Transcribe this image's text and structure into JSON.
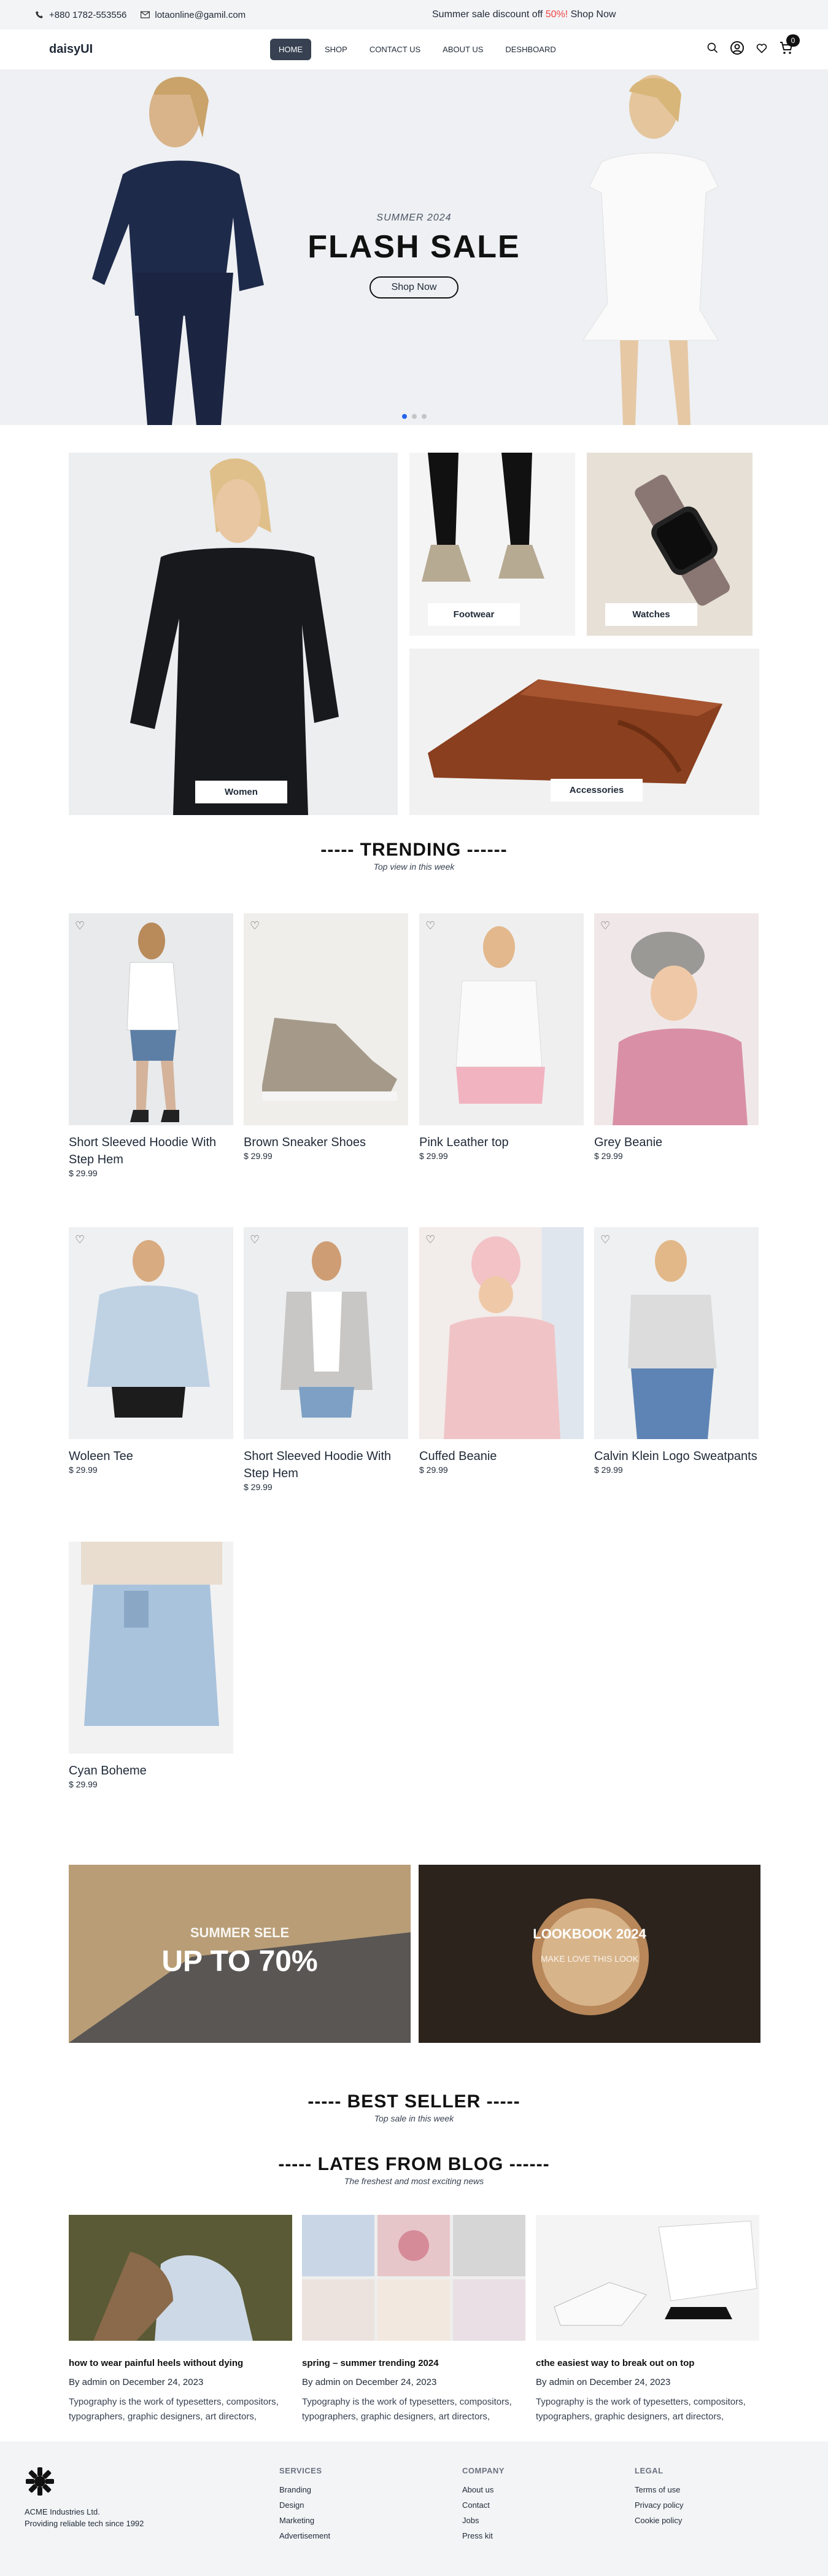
{
  "topbar": {
    "phone": "+880 1782-553556",
    "email": "lotaonline@gamil.com",
    "promo_text": "Summer sale discount off ",
    "promo_highlight": "50%!",
    "promo_link": " Shop Now"
  },
  "nav": {
    "logo": "daisyUI",
    "items": [
      "HOME",
      "SHOP",
      "CONTACT US",
      "ABOUT US",
      "DESHBOARD"
    ],
    "cart_count": "0"
  },
  "hero": {
    "subtitle": "SUMMER 2024",
    "title": "FLASH SALE",
    "button": "Shop Now"
  },
  "categories": [
    "Women",
    "Footwear",
    "Watches",
    "Accessories"
  ],
  "trending": {
    "title": "----- TRENDING ------",
    "subtitle": "Top view in this week"
  },
  "products": [
    {
      "name": "Short Sleeved Hoodie With Step Hem",
      "price": "$ 29.99"
    },
    {
      "name": "Brown Sneaker Shoes",
      "price": "$ 29.99"
    },
    {
      "name": "Pink Leather top",
      "price": "$ 29.99"
    },
    {
      "name": "Grey Beanie",
      "price": "$ 29.99"
    },
    {
      "name": "Woleen Tee",
      "price": "$ 29.99"
    },
    {
      "name": "Short Sleeved Hoodie With Step Hem",
      "price": "$ 29.99"
    },
    {
      "name": "Cuffed Beanie",
      "price": "$ 29.99"
    },
    {
      "name": "Calvin Klein Logo Sweatpants",
      "price": "$ 29.99"
    },
    {
      "name": "Cyan Boheme",
      "price": "$ 29.99"
    }
  ],
  "banners": [
    {
      "small": "SUMMER SELE",
      "big": "UP TO 70%"
    },
    {
      "small": "LOOKBOOK 2024",
      "big": "MAKE LOVE THIS LOOK"
    }
  ],
  "bestseller": {
    "title": "----- BEST SELLER -----",
    "subtitle": "Top sale in this week"
  },
  "blog": {
    "title": "----- LATES FROM BLOG ------",
    "subtitle": "The freshest and most exciting news",
    "posts": [
      {
        "title": "how to wear painful heels without dying",
        "by": "By admin on December 24, 2023",
        "excerpt": "Typography is the work of typesetters, compositors, typographers, graphic designers, art directors,"
      },
      {
        "title": "spring – summer trending 2024",
        "by": "By admin on December 24, 2023",
        "excerpt": "Typography is the work of typesetters, compositors, typographers, graphic designers, art directors,"
      },
      {
        "title": "cthe easiest way to break out on top",
        "by": "By admin on December 24, 2023",
        "excerpt": "Typography is the work of typesetters, compositors, typographers, graphic designers, art directors,"
      }
    ]
  },
  "footer": {
    "company_name": "ACME Industries Ltd.",
    "tagline": "Providing reliable tech since 1992",
    "services_title": "SERVICES",
    "services": [
      "Branding",
      "Design",
      "Marketing",
      "Advertisement"
    ],
    "company_title": "COMPANY",
    "company": [
      "About us",
      "Contact",
      "Jobs",
      "Press kit"
    ],
    "legal_title": "LEGAL",
    "legal": [
      "Terms of use",
      "Privacy policy",
      "Cookie policy"
    ]
  },
  "colors": {
    "accent": "#ef4444",
    "nav_active": "#374151",
    "dot_active": "#2563eb"
  }
}
